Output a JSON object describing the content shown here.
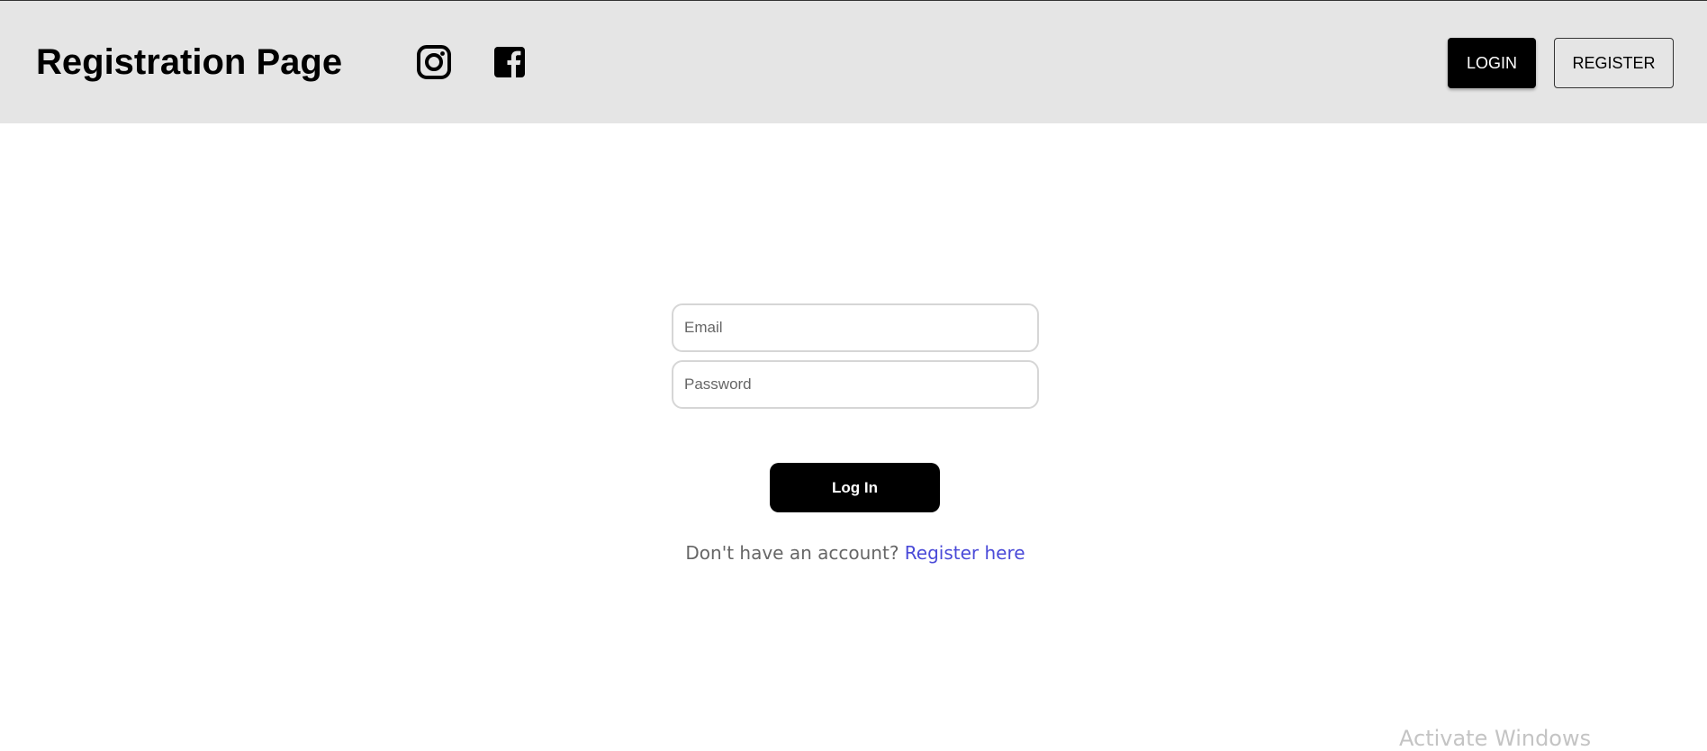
{
  "header": {
    "title": "Registration Page",
    "icons": [
      "instagram-icon",
      "facebook-icon"
    ],
    "nav": {
      "login_label": "LOGIN",
      "register_label": "REGISTER"
    }
  },
  "form": {
    "email_placeholder": "Email",
    "password_placeholder": "Password",
    "submit_label": "Log In",
    "signup_prompt": "Don't have an account?",
    "signup_link": "Register here"
  },
  "watermark": "Activate Windows",
  "colors": {
    "header_bg": "#e5e5e5",
    "primary": "#000000",
    "link": "#4a4ad8"
  }
}
